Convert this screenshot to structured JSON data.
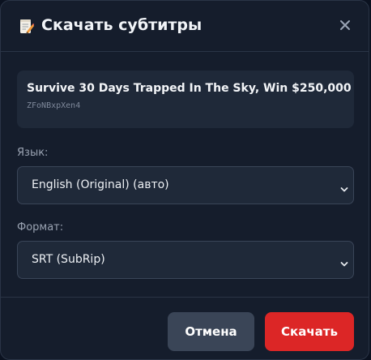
{
  "dialog": {
    "title": "Скачать субтитры",
    "title_icon": "memo-pencil-icon",
    "close_icon": "close-icon"
  },
  "video": {
    "title": "Survive 30 Days Trapped In The Sky, Win $250,000",
    "id": "ZFoNBxpXen4"
  },
  "language": {
    "label": "Язык:",
    "selected": "English (Original) (авто)"
  },
  "format": {
    "label": "Формат:",
    "selected": "SRT (SubRip)"
  },
  "actions": {
    "cancel_label": "Отмена",
    "download_label": "Скачать"
  },
  "colors": {
    "background": "#151d2c",
    "card": "#1f2939",
    "accent": "#dc2626",
    "secondary_button": "#3a4557"
  }
}
